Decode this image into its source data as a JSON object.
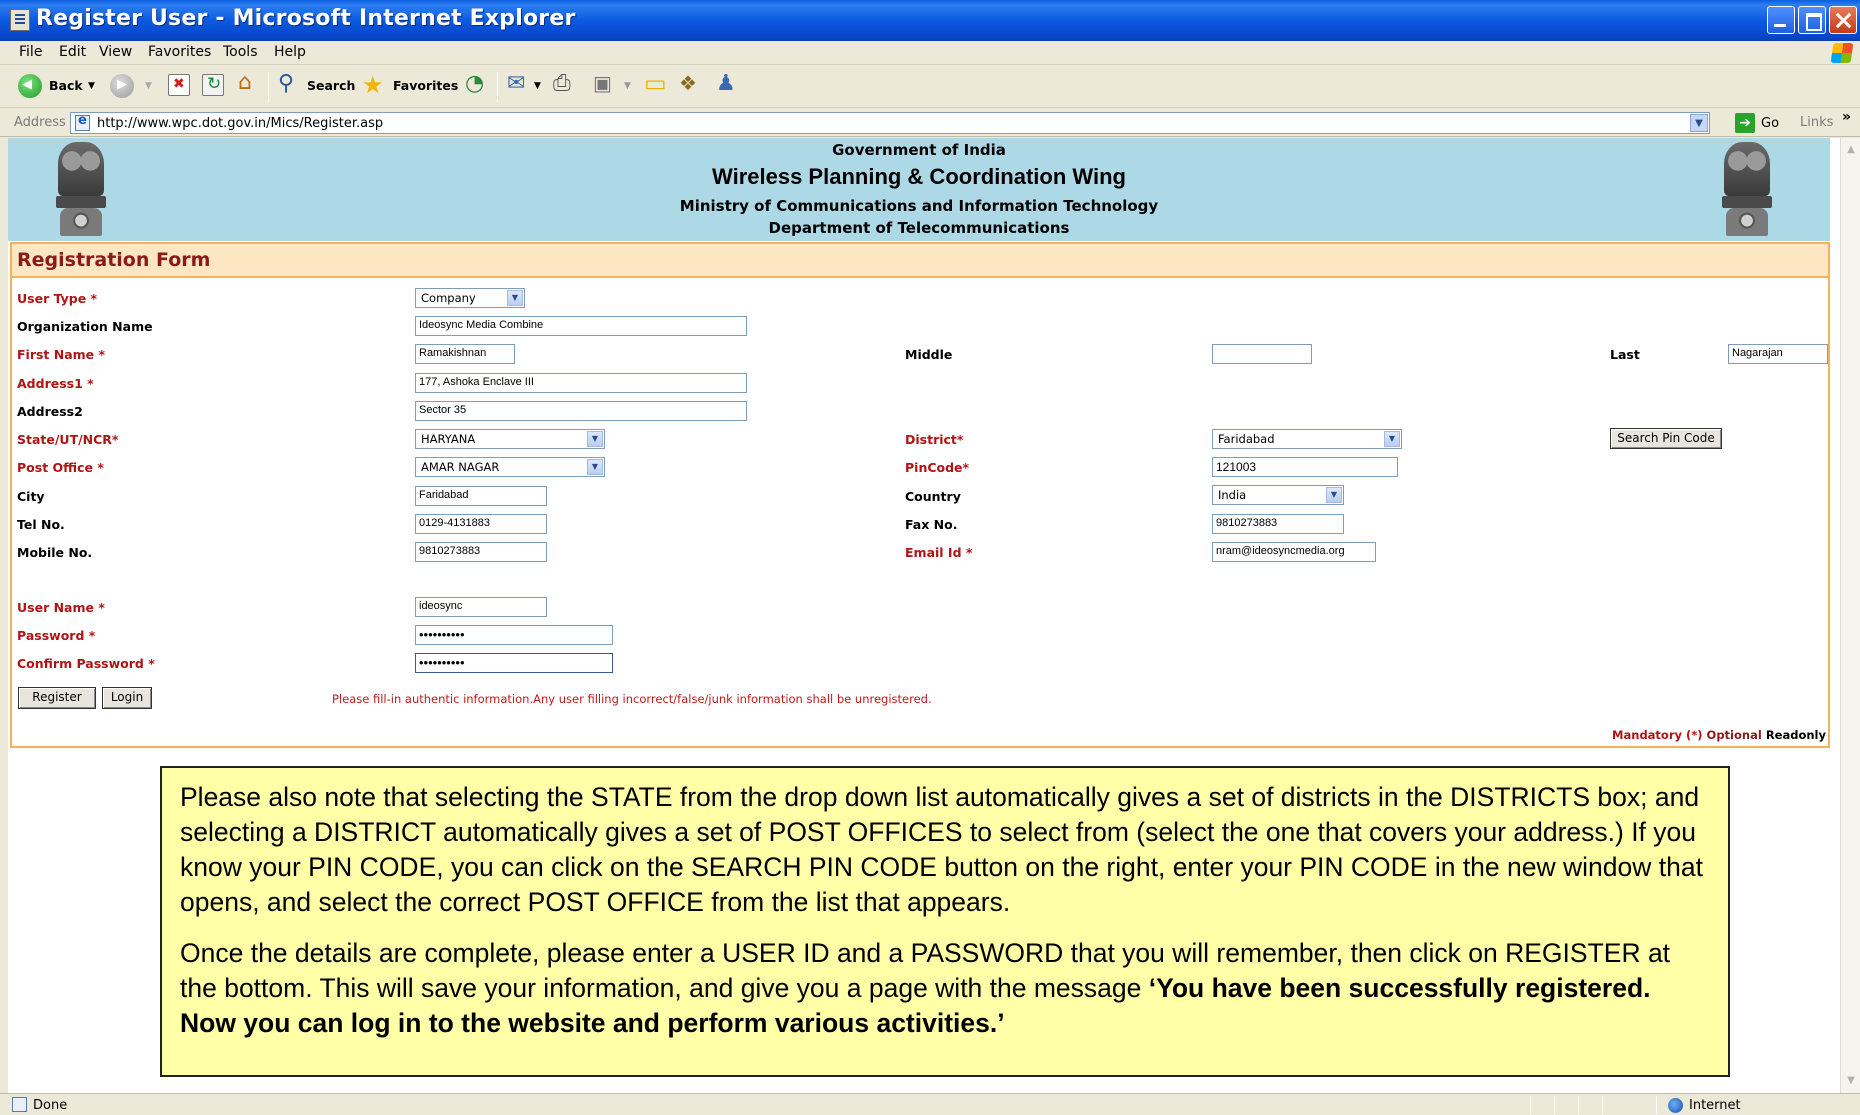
{
  "window": {
    "title": "Register User - Microsoft Internet Explorer"
  },
  "menu": [
    "File",
    "Edit",
    "View",
    "Favorites",
    "Tools",
    "Help"
  ],
  "toolbar": {
    "back": "Back",
    "search": "Search",
    "favorites": "Favorites"
  },
  "address": {
    "label": "Address",
    "url": "http://www.wpc.dot.gov.in/Mics/Register.asp",
    "go": "Go",
    "links": "Links"
  },
  "header": {
    "line1": "Government of India",
    "line2": "Wireless Planning & Coordination Wing",
    "line3": "Ministry of Communications and Information Technology",
    "line4": "Department of Telecommunications"
  },
  "form": {
    "title": "Registration Form",
    "labels": {
      "user_type": "User Type *",
      "org_name": "Organization Name",
      "first_name": "First Name *",
      "middle": "Middle",
      "last": "Last",
      "address1": "Address1 *",
      "address2": "Address2",
      "state": "State/UT/NCR*",
      "district": "District*",
      "post_office": "Post Office *",
      "pincode": "PinCode*",
      "city": "City",
      "country": "Country",
      "tel": "Tel No.",
      "fax": "Fax No.",
      "mobile": "Mobile No.",
      "email": "Email Id *",
      "username": "User Name *",
      "password": "Password *",
      "confirm_password": "Confirm Password *"
    },
    "values": {
      "user_type": "Company",
      "org_name": "Ideosync Media Combine",
      "first_name": "Ramakishnan",
      "middle": "",
      "last": "Nagarajan",
      "address1": "177, Ashoka Enclave III",
      "address2": "Sector 35",
      "state": "HARYANA",
      "district": "Faridabad",
      "post_office": "AMAR NAGAR",
      "pincode": "121003",
      "city": "Faridabad",
      "country": "India",
      "tel": "0129-4131883",
      "fax": "9810273883",
      "mobile": "9810273883",
      "email": "nram@ideosyncmedia.org",
      "username": "ideosync",
      "password": "••••••••••",
      "confirm_password": "••••••••••"
    },
    "buttons": {
      "search_pin": "Search Pin Code",
      "register": "Register",
      "login": "Login"
    },
    "warning": "Please fill-in authentic information.Any user filling incorrect/false/junk information shall be unregistered.",
    "legend": {
      "mandatory": "Mandatory (*)",
      "optional": "Optional",
      "readonly": "Readonly"
    }
  },
  "note": {
    "p1": "Please also note that selecting the STATE from the drop down list automatically gives a set of districts in the DISTRICTS box; and selecting a DISTRICT automatically gives a set of POST OFFICES to select from (select the one that covers your address.) If you know your PIN CODE, you can click on the SEARCH PIN CODE button on the right, enter your PIN CODE in the new window that opens, and select the correct POST OFFICE from the list that appears.",
    "p2_plain": "Once the details are complete, please enter a USER ID and a PASSWORD that you will remember, then click on REGISTER at the bottom. This will save your information, and give you a page with the message ",
    "p2_bold": "‘You have been successfully registered. Now you can log in to the website and perform various activities.’"
  },
  "status": {
    "left": "Done",
    "zone": "Internet"
  },
  "colors": {
    "banner": "#add8e6",
    "form_border": "#f5b25a",
    "title_bar": "#fde7c2",
    "required": "#b01414",
    "note_bg": "#ffffa8"
  }
}
